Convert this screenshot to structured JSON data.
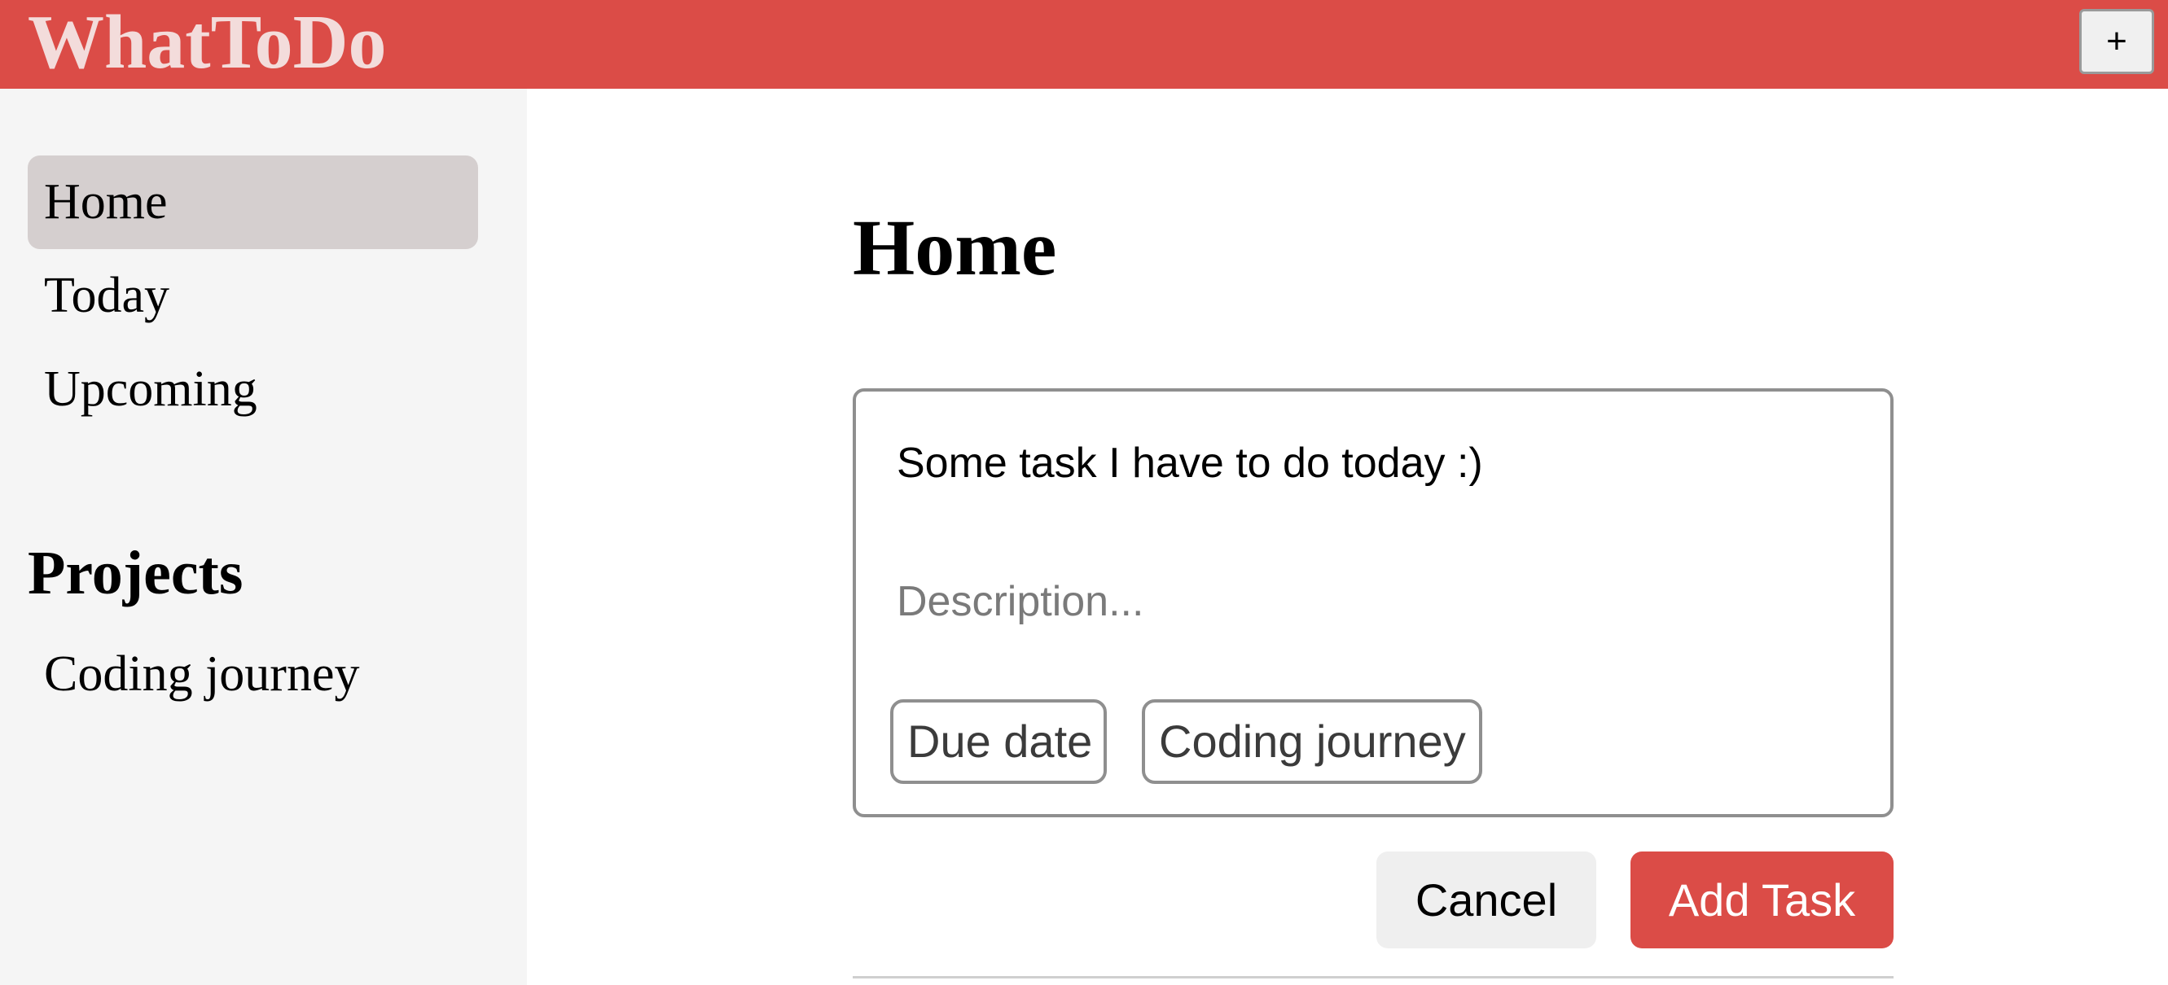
{
  "app": {
    "title": "WhatToDo",
    "add_project_label": "+"
  },
  "sidebar": {
    "items": [
      {
        "label": "Home",
        "active": true
      },
      {
        "label": "Today",
        "active": false
      },
      {
        "label": "Upcoming",
        "active": false
      }
    ],
    "projects_heading": "Projects",
    "projects": [
      {
        "label": "Coding journey"
      }
    ]
  },
  "main": {
    "title": "Home",
    "task_form": {
      "title_value": "Some task I have to do today :)",
      "description_placeholder": "Description...",
      "due_date_label": "Due date",
      "project_label": "Coding journey",
      "cancel_label": "Cancel",
      "submit_label": "Add Task"
    }
  },
  "colors": {
    "brand": "#db4c47",
    "brand_text": "#f3dcdb",
    "active_nav": "#d5cfcf",
    "sidebar_bg": "#f5f5f5"
  },
  "icons": {
    "add_project": "plus-icon"
  }
}
